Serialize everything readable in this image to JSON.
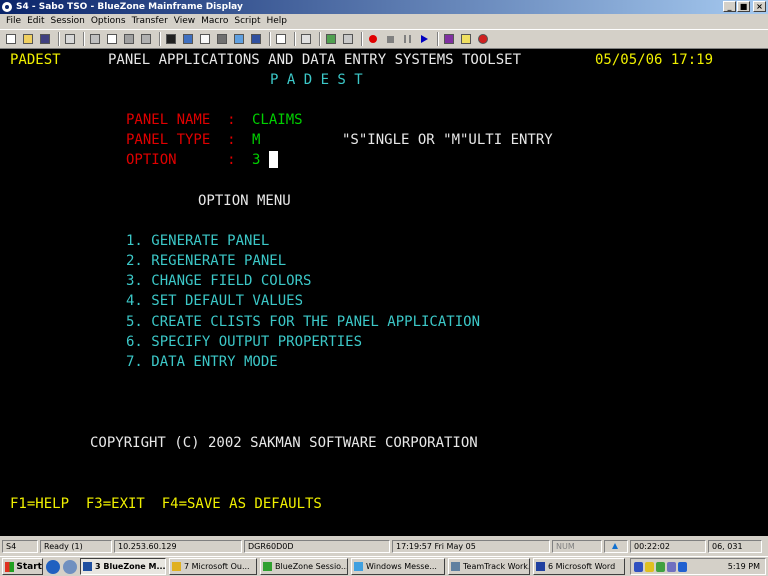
{
  "window": {
    "title": "S4 - Sabo TSO - BlueZone Mainframe Display",
    "controls": {
      "minimize": "_",
      "maximize": "■",
      "close": "×"
    }
  },
  "menu": [
    "File",
    "Edit",
    "Session",
    "Options",
    "Transfer",
    "View",
    "Macro",
    "Script",
    "Help"
  ],
  "terminal": {
    "panel_id": "PADEST",
    "header_title": "PANEL APPLICATIONS AND DATA ENTRY SYSTEMS TOOLSET",
    "datetime": "05/05/06 17:19",
    "subtitle": "P A D E S T",
    "fields": {
      "panel_name_label": "PANEL NAME  :",
      "panel_name_value": "CLAIMS",
      "panel_type_label": "PANEL TYPE  :",
      "panel_type_value": "M",
      "panel_type_hint": "\"S\"INGLE OR \"M\"ULTI ENTRY",
      "option_label": "OPTION      :",
      "option_value": "3"
    },
    "menu_title": "OPTION MENU",
    "options": [
      "1. GENERATE PANEL",
      "2. REGENERATE PANEL",
      "3. CHANGE FIELD COLORS",
      "4. SET DEFAULT VALUES",
      "5. CREATE CLISTS FOR THE PANEL APPLICATION",
      "6. SPECIFY OUTPUT PROPERTIES",
      "7. DATA ENTRY MODE"
    ],
    "copyright": "COPYRIGHT (C) 2002 SAKMAN SOFTWARE CORPORATION",
    "function_keys": "F1=HELP  F3=EXIT  F4=SAVE AS DEFAULTS"
  },
  "status": {
    "session": "S4",
    "state": "Ready (1)",
    "ip": "10.253.60.129",
    "terminal_id": "DGR60D0D",
    "timestamp": "17:19:57 Fri May 05",
    "num": "NUM",
    "elapsed": "00:22:02",
    "cursor_pos": "06, 031"
  },
  "taskbar": {
    "start": "Start",
    "tasks": [
      "3 BlueZone M...",
      "7 Microsoft Ou...",
      "BlueZone Sessio...",
      "Windows Messe...",
      "TeamTrack Work...",
      "6 Microsoft Word"
    ],
    "clock": "5:19 PM"
  },
  "colors": {
    "terminal_bg": "#000000",
    "yellow": "#f0f000",
    "cyan": "#3cc8c8",
    "red": "#e00000",
    "green": "#00d000",
    "titlebar": "#0a246a"
  }
}
